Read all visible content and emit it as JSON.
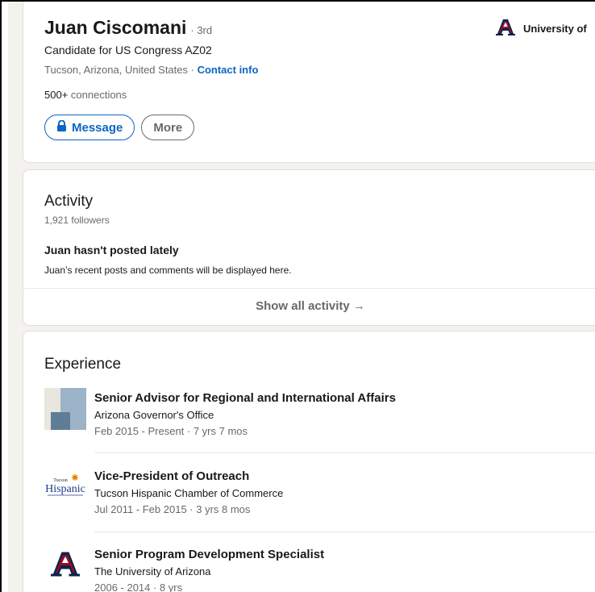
{
  "profile": {
    "name": "Juan Ciscomani",
    "degree": "· 3rd",
    "headline": "Candidate for US Congress AZ02",
    "location": "Tucson, Arizona, United States · ",
    "contact_info": "Contact info",
    "connections_count": "500+",
    "connections_label": " connections",
    "school": "University of",
    "buttons": {
      "message": "Message",
      "more": "More"
    }
  },
  "activity": {
    "title": "Activity",
    "followers": "1,921 followers",
    "empty_title": "Juan hasn't posted lately",
    "empty_sub": "Juan’s recent posts and comments will be displayed here.",
    "show_all": "Show all activity →"
  },
  "experience": {
    "title": "Experience",
    "items": [
      {
        "title": "Senior Advisor for Regional and International Affairs",
        "company": "Arizona Governor's Office",
        "dates": "Feb 2015 - Present · 7 yrs 7 mos"
      },
      {
        "title": "Vice-President of Outreach",
        "company": "Tucson Hispanic Chamber of Commerce",
        "dates": "Jul 2011 - Feb 2015 · 3 yrs 8 mos",
        "logo_text_top": "Tucson",
        "logo_text_main": "Hispanic"
      },
      {
        "title": "Senior Program Development Specialist",
        "company": "The University of Arizona",
        "dates": "2006 - 2014 · 8 yrs"
      }
    ]
  },
  "colors": {
    "link_blue": "#0a66c2",
    "arizona_red": "#ab0520",
    "arizona_navy": "#0c234b",
    "page_bg": "#f4f2ee"
  }
}
